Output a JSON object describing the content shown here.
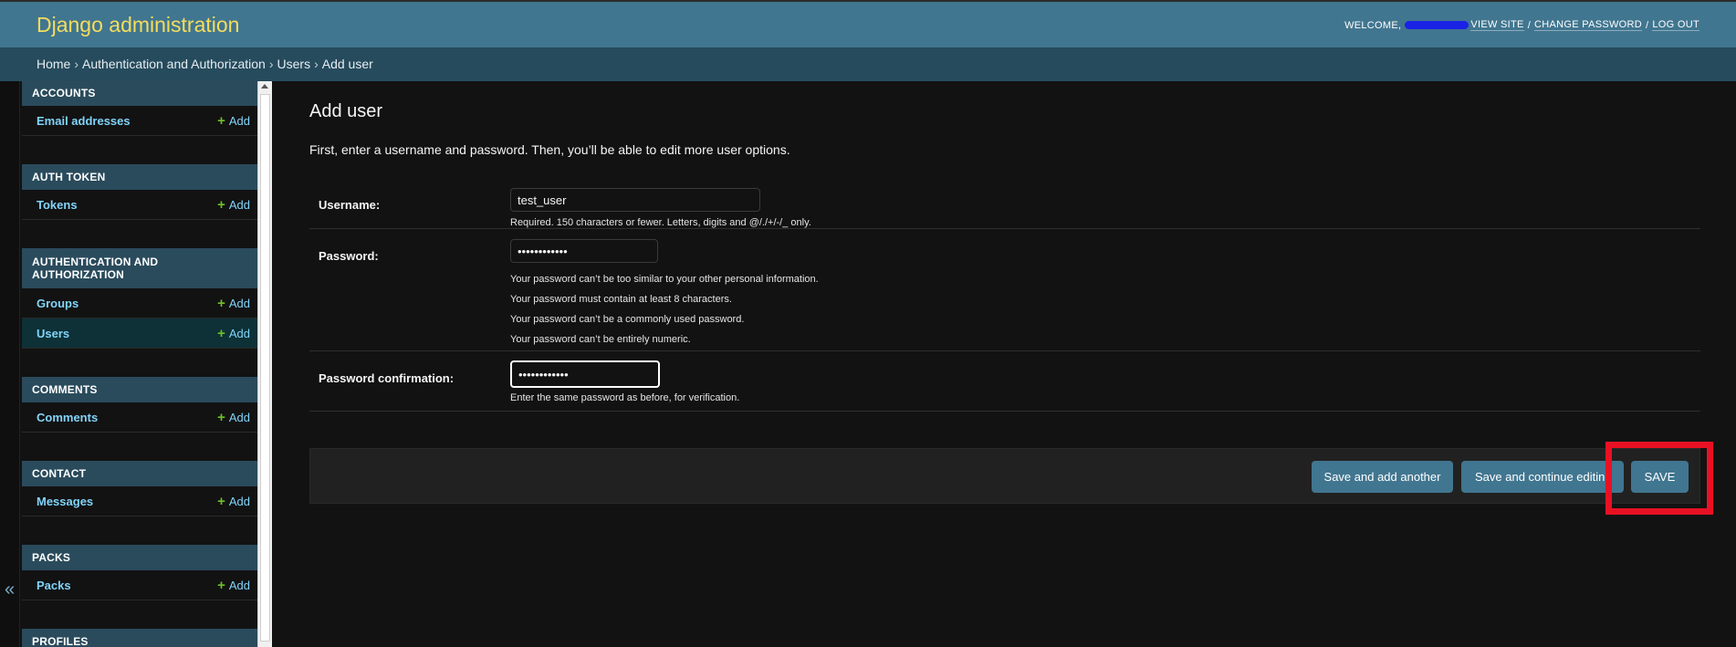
{
  "header": {
    "site_title": "Django administration",
    "welcome": "WELCOME,",
    "view_site": "VIEW SITE",
    "change_password": "CHANGE PASSWORD",
    "log_out": "LOG OUT",
    "separator": "/"
  },
  "breadcrumbs": [
    "Home",
    "Authentication and Authorization",
    "Users",
    "Add user"
  ],
  "breadcrumb_arrow": "›",
  "nav_toggle": "«",
  "sidebar": {
    "add_label": "Add",
    "modules": [
      {
        "header": "ACCOUNTS",
        "items": [
          "Email addresses"
        ]
      },
      {
        "header": "AUTH TOKEN",
        "items": [
          "Tokens"
        ]
      },
      {
        "header": "AUTHENTICATION AND AUTHORIZATION",
        "items": [
          "Groups",
          "Users"
        ]
      },
      {
        "header": "COMMENTS",
        "items": [
          "Comments"
        ]
      },
      {
        "header": "CONTACT",
        "items": [
          "Messages"
        ]
      },
      {
        "header": "PACKS",
        "items": [
          "Packs"
        ]
      },
      {
        "header": "PROFILES",
        "items": []
      }
    ],
    "selected": "Users"
  },
  "main": {
    "title": "Add user",
    "intro": "First, enter a username and password. Then, you’ll be able to edit more user options.",
    "fields": {
      "username": {
        "label": "Username:",
        "value": "test_user",
        "help": "Required. 150 characters or fewer. Letters, digits and @/./+/-/_ only."
      },
      "password": {
        "label": "Password:",
        "value": "••••••••••••",
        "help": [
          "Your password can’t be too similar to your other personal information.",
          "Your password must contain at least 8 characters.",
          "Your password can’t be a commonly used password.",
          "Your password can’t be entirely numeric."
        ]
      },
      "password_confirmation": {
        "label": "Password confirmation:",
        "value": "••••••••••••",
        "help": "Enter the same password as before, for verification."
      }
    },
    "buttons": {
      "save_add_another": "Save and add another",
      "save_continue": "Save and continue editing",
      "save": "SAVE"
    }
  },
  "colors": {
    "header_bg": "#417690",
    "breadcrumb_bg": "#264b5d",
    "accent_yellow": "#f5dd5d",
    "link_blue": "#81d4fa",
    "add_green": "#70bf2b",
    "highlight_red": "#e81123"
  }
}
